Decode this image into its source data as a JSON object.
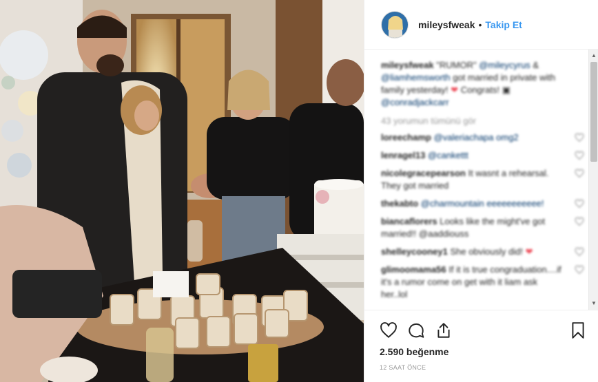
{
  "user": {
    "username": "mileysfweak",
    "separator": "•",
    "follow_label": "Takip Et"
  },
  "caption": {
    "username": "mileysfweak",
    "text_1": "\"RUMOR\"",
    "mention_1": "@mileycyrus",
    "text_2": "&",
    "mention_2": "@liamhemsworth",
    "text_3": "got married in private with family yesterday!",
    "text_4": "Congrats!",
    "mention_3": "@conradjackcarr"
  },
  "view_more": "43 yorumun tümünü gör",
  "comments": [
    {
      "user": "loreechamp",
      "text": "@valeriachapa omg2"
    },
    {
      "user": "lenragel13",
      "text": "@cankettt"
    },
    {
      "user": "nicolegracepearson",
      "text": "It wasnt a rehearsal. They got married"
    },
    {
      "user": "thekabto",
      "text": "@charmountain eeeeeeeeeee!"
    },
    {
      "user": "biancaflorers",
      "text": "Looks like the might've got married!! @aaddiouss"
    },
    {
      "user": "shelleycooney1",
      "text": "She obviously did!"
    },
    {
      "user": "glimoomama56",
      "text": "If it is true congraduation....if it's a rumor come on get with it liam ask her..lol"
    }
  ],
  "likes": "2.590 beğenme",
  "timestamp": "12 SAAT ÖNCE",
  "icons": {
    "like": "heart-outline-icon",
    "comment": "speech-bubble-icon",
    "share": "share-upload-icon",
    "save": "bookmark-icon"
  },
  "colors": {
    "link": "#3897f0",
    "mention": "#003569",
    "text": "#262626",
    "muted": "#999999",
    "heart_red": "#ed4956"
  }
}
